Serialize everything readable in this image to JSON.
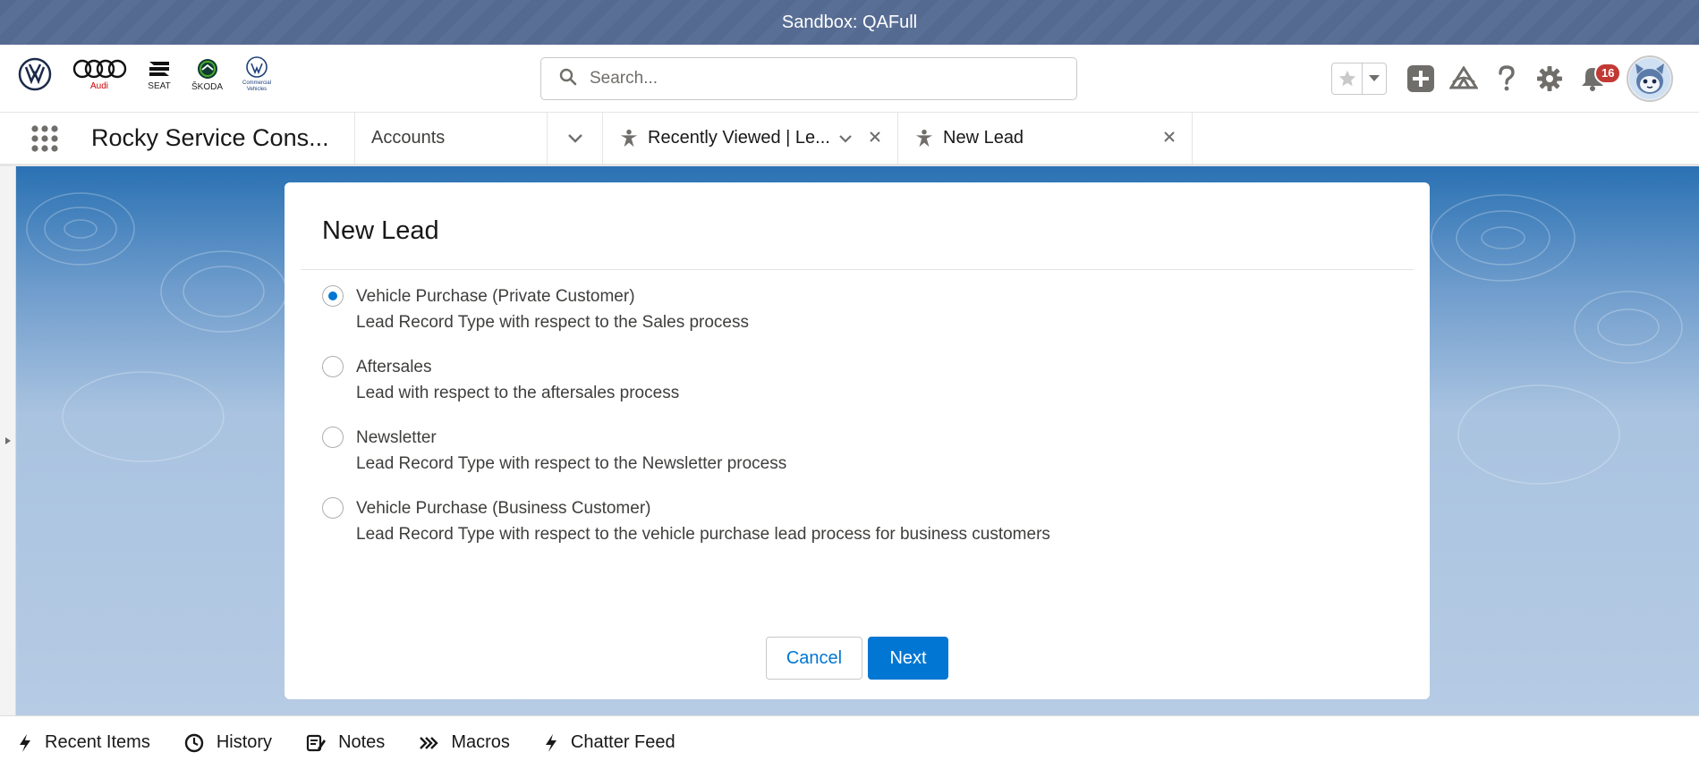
{
  "sandbox_bar": {
    "text": "Sandbox: QAFull"
  },
  "brand_logos": [
    {
      "name": "vw",
      "caption": ""
    },
    {
      "name": "audi",
      "caption": "Audi"
    },
    {
      "name": "seat",
      "caption": "SEAT"
    },
    {
      "name": "skoda",
      "caption": "ŠKODA"
    },
    {
      "name": "vw-commercial",
      "caption": "Commercial Vehicles"
    }
  ],
  "search": {
    "placeholder": "Search..."
  },
  "notifications": {
    "count": "16"
  },
  "nav": {
    "app_name": "Rocky Service Cons...",
    "tabs": [
      {
        "label": "Accounts"
      },
      {
        "label": "Recently Viewed | Le..."
      },
      {
        "label": "New Lead"
      }
    ]
  },
  "modal": {
    "title": "New Lead",
    "options": [
      {
        "label": "Vehicle Purchase (Private Customer)",
        "description": "Lead Record Type with respect to the Sales process",
        "selected": true
      },
      {
        "label": "Aftersales",
        "description": "Lead with respect to the aftersales process",
        "selected": false
      },
      {
        "label": "Newsletter",
        "description": "Lead Record Type with respect to the Newsletter process",
        "selected": false
      },
      {
        "label": "Vehicle Purchase (Business Customer)",
        "description": "Lead Record Type with respect to the vehicle purchase lead process for business customers",
        "selected": false
      }
    ],
    "cancel_label": "Cancel",
    "next_label": "Next"
  },
  "utility_bar": {
    "items": [
      {
        "label": "Recent Items",
        "icon": "lightning-icon"
      },
      {
        "label": "History",
        "icon": "clock-icon"
      },
      {
        "label": "Notes",
        "icon": "notes-icon"
      },
      {
        "label": "Macros",
        "icon": "macros-icon"
      },
      {
        "label": "Chatter Feed",
        "icon": "lightning-icon"
      }
    ]
  },
  "colors": {
    "brand_blue": "#0176d3",
    "badge_red": "#c23934",
    "sandbox_bar": "#556a91"
  }
}
